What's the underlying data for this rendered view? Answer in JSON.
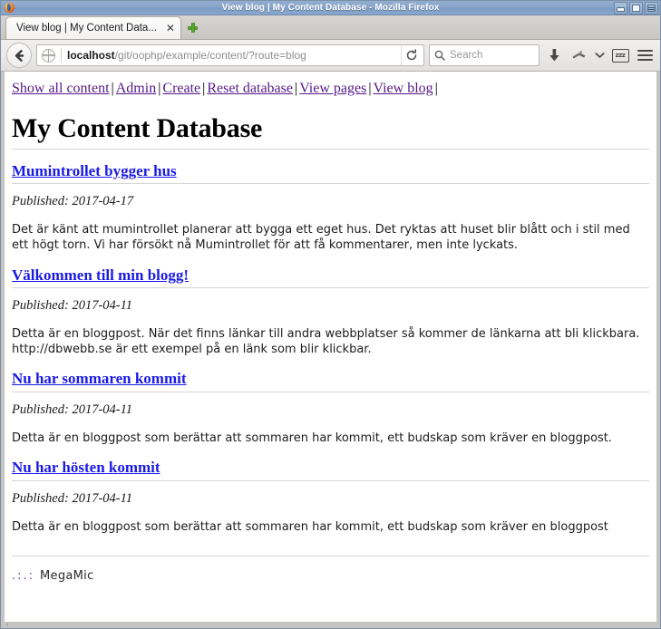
{
  "window": {
    "title": "View blog | My Content Database - Mozilla Firefox",
    "logo_icon": "firefox-logo-icon",
    "controls": {
      "minimize_icon": "minimize-icon",
      "maximize_icon": "maximize-icon",
      "close_icon": "close-icon"
    }
  },
  "tabs": [
    {
      "label": "View blog | My Content Data...",
      "close_icon": "close-icon"
    }
  ],
  "new_tab": {
    "icon": "plus-icon",
    "label": ""
  },
  "toolbar": {
    "back_icon": "back-arrow-icon",
    "site_identity_icon": "globe-icon",
    "url_host": "localhost",
    "url_path": "/git/oophp/example/content/?route=blog",
    "url_full": "localhost/git/oophp/example/content/?route=blog",
    "reload_icon": "reload-icon",
    "search_icon": "search-icon",
    "search_placeholder": "Search",
    "search_value": "",
    "downloads_icon": "download-arrow-icon",
    "pocket_icon": "pocket-icon",
    "pocket_chevron_icon": "chevron-down-icon",
    "reader_icon": "reader-mode-icon",
    "reader_label": "zzz",
    "menu_icon": "hamburger-menu-icon"
  },
  "page": {
    "nav": {
      "separator": "|",
      "links": [
        "Show all content",
        "Admin",
        "Create",
        "Reset database",
        "View pages",
        "View blog"
      ]
    },
    "heading": "My Content Database",
    "posts": [
      {
        "title": "Mumintrollet bygger hus",
        "published": "Published: 2017-04-17",
        "body": "Det är känt att mumintrollet planerar att bygga ett eget hus. Det ryktas att huset blir blått och i stil med ett högt torn. Vi har försökt nå Mumintrollet för att få kommentarer, men inte lyckats."
      },
      {
        "title": "Välkommen till min blogg!",
        "published": "Published: 2017-04-11",
        "body": "Detta är en bloggpost. När det finns länkar till andra webbplatser så kommer de länkarna att bli klickbara. http://dbwebb.se är ett exempel på en länk som blir klickbar."
      },
      {
        "title": "Nu har sommaren kommit",
        "published": "Published: 2017-04-11",
        "body": "Detta är en bloggpost som berättar att sommaren har kommit, ett budskap som kräver en bloggpost."
      },
      {
        "title": "Nu har hösten kommit",
        "published": "Published: 2017-04-11",
        "body": "Detta är en bloggpost som berättar att sommaren har kommit, ett budskap som kräver en bloggpost"
      }
    ],
    "footer": {
      "dots": ".:.:",
      "name": "MegaMic"
    }
  },
  "colors": {
    "titlebar": "#86a3c9",
    "visited_link": "#551a8b",
    "link": "#1a1ae6",
    "footer_dots": "#7a3f9d",
    "rule": "#d5d5d5",
    "page_background": "#ffffff"
  }
}
